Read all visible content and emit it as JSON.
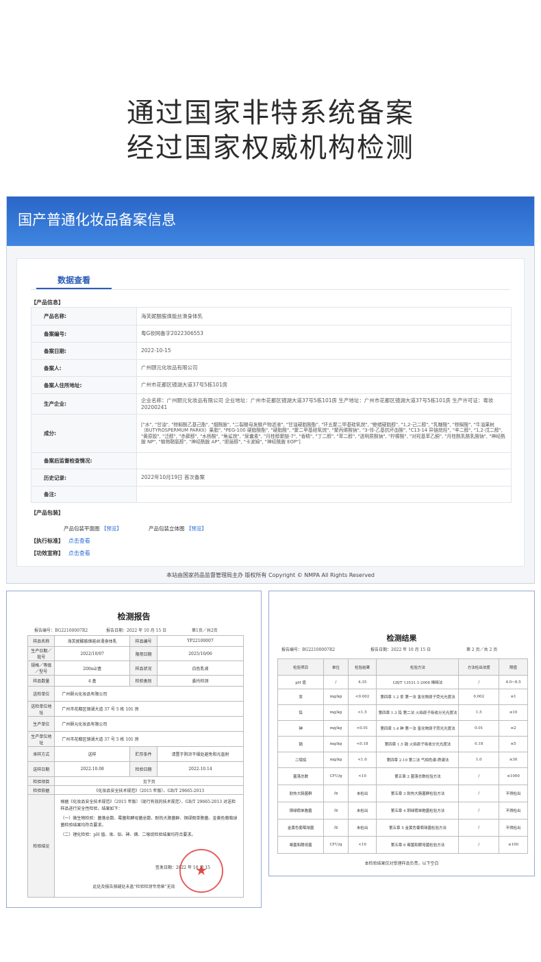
{
  "hero": {
    "line1": "通过国家非特系统备案",
    "line2": "经过国家权威机构检测"
  },
  "portal": {
    "header_title": "国产普通化妆品备案信息",
    "tab": "数据查看",
    "product_info_title": "【产品信息】",
    "rows": [
      {
        "k": "产品名称:",
        "v": "海芙妮酸胺焕能丝滑身体乳"
      },
      {
        "k": "备案编号:",
        "v": "粤G妆网备字2022306553"
      },
      {
        "k": "备案日期:",
        "v": "2022-10-15"
      },
      {
        "k": "备案人:",
        "v": "广州颐元化妆品有限公司"
      },
      {
        "k": "备案人住所地址:",
        "v": "广州市花都区镜湖大道37号5栋101房"
      },
      {
        "k": "生产企业:",
        "v": "企业名称：广州颐元化妆品有限公司 企业地址：广州市花都区镜湖大道37号5栋101房 生产地址：广州市花都区镜湖大道37号5栋101房 生产许可证：粤妆20200241"
      },
      {
        "k": "成分:",
        "v": "[\"水\", \"甘油\", \"棕榈酸乙基己酯\", \"烟酰胺\", \"二裂酵母发酵产物滤液\", \"甘油硬脂酸酯\", \"环五聚二甲基硅氧烷\", \"鲸蜡硬脂醇\", \"1,2-己二醇\", \"乳糖酸\", \"棕榈酸\", \"牛油果树（BUTYROSPERMUM PARKII）果脂\", \"PEG-100 硬脂酸酯\", \"硬脂酸\", \"聚二甲基硅氧烷\", \"聚丙烯酸钠\", \"3-邻-乙基抗坏血酸\", \"C13-14 异链烷烃\", \"辛二醇\", \"1,2-戊二醇\", \"黄原胶\", \"泛醇\", \"赤藓醇\", \"水杨酸\", \"角鲨烷\", \"尿囊素\", \"月桂醇聚醚-7\", \"香精\", \"丁二醇\", \"苯二醇\", \"透明质酸钠\", \"柠檬酸\", \"对羟基苯乙酮\", \"月桂酰乳酰乳酸钠\", \"神经酰胺 NP\", \"植物鞘氨醇\", \"神经酰胺 AP\", \"胆甾醇\", \"卡波姆\", \"神经酰胺 EOP\"]"
      },
      {
        "k": "备案后监督检查情况:",
        "v": ""
      },
      {
        "k": "历史记录:",
        "v": "2022年10月19日 首次备案"
      },
      {
        "k": "备注:",
        "v": ""
      }
    ],
    "packaging_title": "【产品包装】",
    "pack_front": "产品包装平面图",
    "pack_3d": "产品包装立体图",
    "preview": "【预览】",
    "standard_label": "【执行标准】",
    "efficacy_label": "【功效宣称】",
    "view_link": "点击查看",
    "footer": "本站由国家药品监督管理局主办 版权所有 Copyright © NMPA All Rights Reserved"
  },
  "report1": {
    "title": "检测报告",
    "report_no": "报告编号：BG22100007R2",
    "report_date": "报告日期：2022 年 10 月 15 日",
    "page": "第1页／共2页",
    "rows": [
      [
        "样品名称",
        "海芙妮酸胺焕能丝滑身体乳",
        "样品编号",
        "YP22100007"
      ],
      [
        "生产日期／批号",
        "2022/10/07",
        "限用日期",
        "2025/10/06"
      ],
      [
        "规格／等级／型号",
        "200ml/盒",
        "样品状况",
        "白色乳液"
      ],
      [
        "样品数量",
        "4 盒",
        "检验类别",
        "委托检测"
      ]
    ],
    "entrust_unit_label": "送检单位",
    "entrust_unit": "广州颐元化妆品有限公司",
    "entrust_addr_label": "送检单位地址",
    "entrust_addr": "广州市花都区镜湖大道 37 号 5 栋 101 房",
    "producer_label": "生产单位",
    "producer": "广州颐元化妆品有限公司",
    "producer_addr_label": "生产单位地址",
    "producer_addr": "广州市花都区镜湖大道 37 号 5 栋 101 房",
    "sample_method_label": "来样方式",
    "sample_method": "送样",
    "storage_label": "贮存条件",
    "storage": "请置于阴凉干燥处避免阳光直射",
    "receive_date_label": "送样日期",
    "receive_date": "2022.10.08",
    "test_date_label": "检验日期",
    "test_date": "2022.10.14",
    "items_label": "检验项目",
    "items": "见下页",
    "basis_label": "检验依据",
    "basis": "《化妆品安全技术规范》（2015 年版）、GB/T 29665-2013",
    "conclusion_label": "检验结论",
    "conclusion_p1": "根据《化妆品安全技术规范》（2015 年版）（现行有效的技术规范）、GB/T 29665-2013 对送检样品进行安全性检验，结果如下：",
    "conclusion_p2": "（一）微生物检验：菌落总数、霉菌和酵母菌总数、耐热大肠菌群、铜绿假单胞菌、金黄色葡萄球菌检验结果均符合要求。",
    "conclusion_p3": "（二）理化检验：pH 值、汞、铅、砷、镉、二噁烷检验结果均符合要求。",
    "sign_date": "签发日期：2022 年 10 月 15",
    "stamp": "★",
    "footer": "此处及报告骑缝处未盖“检验检测专用章”无效"
  },
  "report2": {
    "title": "检测结果",
    "report_no": "报告编号：BG22100007R2",
    "report_date": "报告日期：2022 年 10 月 15 日",
    "page": "第 2 页／共 2 页",
    "headers": [
      "检验项目",
      "单位",
      "检验结果",
      "检验方法",
      "方法检出浓度",
      "限值"
    ],
    "rows": [
      [
        "pH 值",
        "/",
        "4.35",
        "GB/T 13531.1-2008 稀释法",
        "/",
        "4.0~8.5"
      ],
      [
        "汞",
        "mg/kg",
        "<0.002",
        "第四章 1.2 汞 第一法 氢化物原子荧光光度法",
        "0.002",
        "≤1"
      ],
      [
        "铅",
        "mg/kg",
        "<1.5",
        "第四章 1.3 铅 第二法 火焰原子吸收分光光度法",
        "1.5",
        "≤10"
      ],
      [
        "砷",
        "mg/kg",
        "<0.01",
        "第四章 1.4 砷 第一法 氢化物原子荧光光度法",
        "0.01",
        "≤2"
      ],
      [
        "镉",
        "mg/kg",
        "<0.18",
        "第四章 1.5 镉 火焰原子吸收分光光度法",
        "0.18",
        "≤5"
      ],
      [
        "二噁烷",
        "mg/kg",
        "<1.0",
        "第四章 2.19 第二法 气相色谱-质谱法",
        "1.0",
        "≤30"
      ],
      [
        "菌落总数",
        "CFU/g",
        "<10",
        "第五章 2 菌落总数检验方法",
        "/",
        "≤1000"
      ],
      [
        "耐热大肠菌群",
        "/g",
        "未检出",
        "第五章 3 耐热大肠菌群检验方法",
        "/",
        "不得检出"
      ],
      [
        "铜绿假单胞菌",
        "/g",
        "未检出",
        "第五章 4 铜绿假单胞菌检验方法",
        "/",
        "不得检出"
      ],
      [
        "金黄色葡萄球菌",
        "/g",
        "未检出",
        "第五章 5 金黄色葡萄球菌检验方法",
        "/",
        "不得检出"
      ],
      [
        "霉菌和酵母菌",
        "CFU/g",
        "<10",
        "第五章 6 霉菌和酵母菌检验方法",
        "/",
        "≤100"
      ]
    ],
    "footer": "本检验结果仅对受理样品负责，以下空白"
  }
}
